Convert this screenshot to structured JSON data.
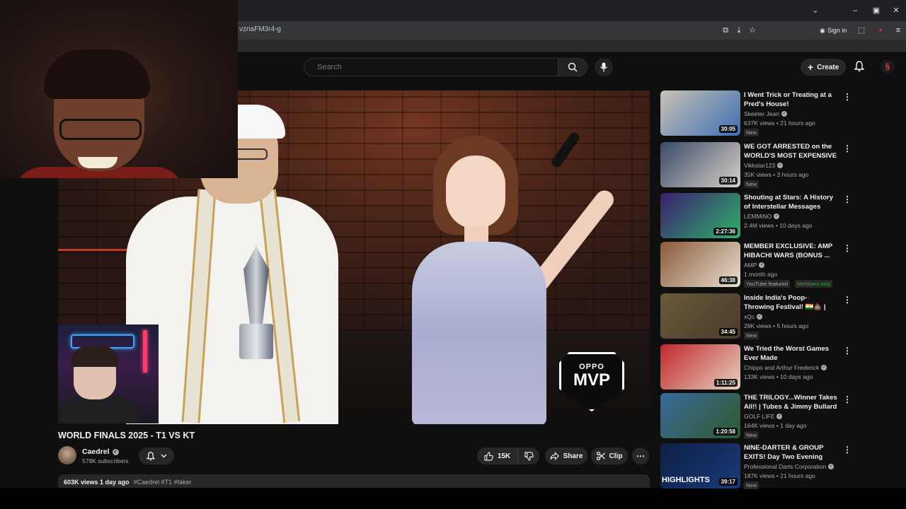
{
  "browser": {
    "url": "vznaFM3r4-g",
    "sign_in": "Sign in"
  },
  "header": {
    "search_placeholder": "Search",
    "create_label": "Create"
  },
  "player": {
    "badge_brand": "OPPO",
    "badge_title": "MVP"
  },
  "video": {
    "title": "WORLD FINALS 2025 - T1 VS KT",
    "channel": "Caedrel",
    "subscribers": "578K subscribers",
    "likes": "15K",
    "share_label": "Share",
    "clip_label": "Clip",
    "views_date": "603K views  1 day ago",
    "tags": "#Caedrel #T1 #faker"
  },
  "recommendations": [
    {
      "title": "I Went Trick or Treating at a Pred's House!",
      "channel": "Skeeter Jean",
      "stats": "637K views • 21 hours ago",
      "duration": "30:05",
      "badge": "New",
      "colors": [
        "#c9c2b6",
        "#3d6fb5"
      ]
    },
    {
      "title": "WE GOT ARRESTED on the WORLD'S MOST EXPENSIVE ...",
      "channel": "Vikkstar123",
      "stats": "35K views • 3 hours ago",
      "duration": "30:14",
      "badge": "New",
      "colors": [
        "#3a4a6a",
        "#d8d0c8"
      ]
    },
    {
      "title": "Shouting at Stars: A History of Interstellar Messages",
      "channel": "LEMMiNO",
      "stats": "2.4M views • 10 days ago",
      "duration": "2:27:36",
      "badge": "",
      "colors": [
        "#3b1f6e",
        "#2fb06a"
      ]
    },
    {
      "title": "MEMBER EXCLUSIVE: AMP HIBACHI WARS (BONUS ...",
      "channel": "AMP",
      "stats": "1 month ago",
      "duration": "46:38",
      "badge": "YouTube featured",
      "badge2": "Members only",
      "colors": [
        "#8a5a3a",
        "#e8e0d0"
      ]
    },
    {
      "title": "Inside India's Poop-Throwing Festival! 🇮🇳💩 | xQc Reacts",
      "channel": "xQc",
      "stats": "26K views • 5 hours ago",
      "duration": "34:45",
      "badge": "New",
      "colors": [
        "#6a5a3a",
        "#4a3a2a"
      ]
    },
    {
      "title": "We Tried the Worst Games Ever Made",
      "channel": "Chippo and Arthur Frederick",
      "stats": "133K views • 10 days ago",
      "duration": "1:11:25",
      "badge": "",
      "colors": [
        "#c0282a",
        "#e8d0c0"
      ]
    },
    {
      "title": "THE TRILOGY...Winner Takes All!! | Tubes & Jimmy Bullard V...",
      "channel": "GOLF LIFE",
      "stats": "164K views • 1 day ago",
      "duration": "1:20:58",
      "badge": "New",
      "colors": [
        "#3a6a9a",
        "#2e5a2e"
      ]
    },
    {
      "title": "NINE-DARTER & GROUP EXITS! Day Two Evening Highlights - ...",
      "channel": "Professional Darts Corporation",
      "stats": "187K views • 21 hours ago",
      "duration": "39:17",
      "badge": "New",
      "thumb_text": "HIGHLIGHTS",
      "colors": [
        "#0d1f44",
        "#1a3a7a"
      ]
    }
  ]
}
